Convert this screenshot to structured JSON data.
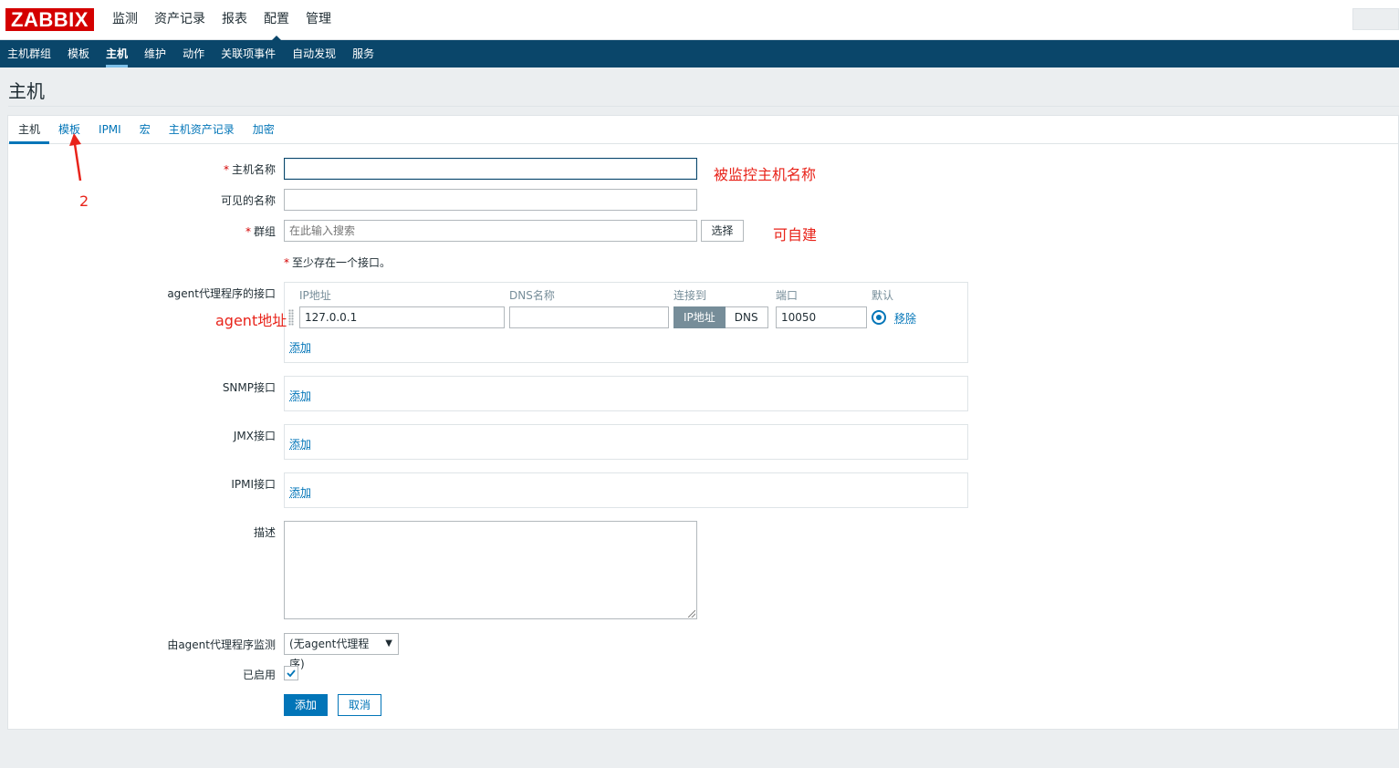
{
  "header": {
    "logo": "ZABBIX",
    "nav": [
      "监测",
      "资产记录",
      "报表",
      "配置",
      "管理"
    ],
    "active_index": 3
  },
  "subnav": {
    "items": [
      "主机群组",
      "模板",
      "主机",
      "维护",
      "动作",
      "关联项事件",
      "自动发现",
      "服务"
    ],
    "active_index": 2
  },
  "page": {
    "title": "主机"
  },
  "tabs": [
    "主机",
    "模板",
    "IPMI",
    "宏",
    "主机资产记录",
    "加密"
  ],
  "form": {
    "host_name_label": "主机名称",
    "host_name_value": "",
    "visible_name_label": "可见的名称",
    "visible_name_value": "",
    "groups_label": "群组",
    "groups_placeholder": "在此输入搜索",
    "select_button": "选择",
    "interface_note": "至少存在一个接口。",
    "agent_iface_label": "agent代理程序的接口",
    "iface_headers": {
      "ip": "IP地址",
      "dns": "DNS名称",
      "connect": "连接到",
      "port": "端口",
      "default": "默认"
    },
    "iface_row": {
      "ip": "127.0.0.1",
      "dns": "",
      "connect_ip": "IP地址",
      "connect_dns": "DNS",
      "port": "10050",
      "remove": "移除"
    },
    "add_link": "添加",
    "snmp_label": "SNMP接口",
    "jmx_label": "JMX接口",
    "ipmi_label": "IPMI接口",
    "description_label": "描述",
    "proxy_label": "由agent代理程序监测",
    "proxy_value": "(无agent代理程序)",
    "enabled_label": "已启用",
    "enabled": true,
    "add_button": "添加",
    "cancel_button": "取消"
  },
  "annotations": {
    "host_name_note": "被监控主机名称",
    "group_note": "可自建",
    "agent_note": "agent地址",
    "step_number": "2"
  },
  "colors": {
    "brand_red": "#d40000",
    "nav_blue": "#0a466a",
    "link_blue": "#0275b8",
    "annotation_red": "#e8231a"
  }
}
